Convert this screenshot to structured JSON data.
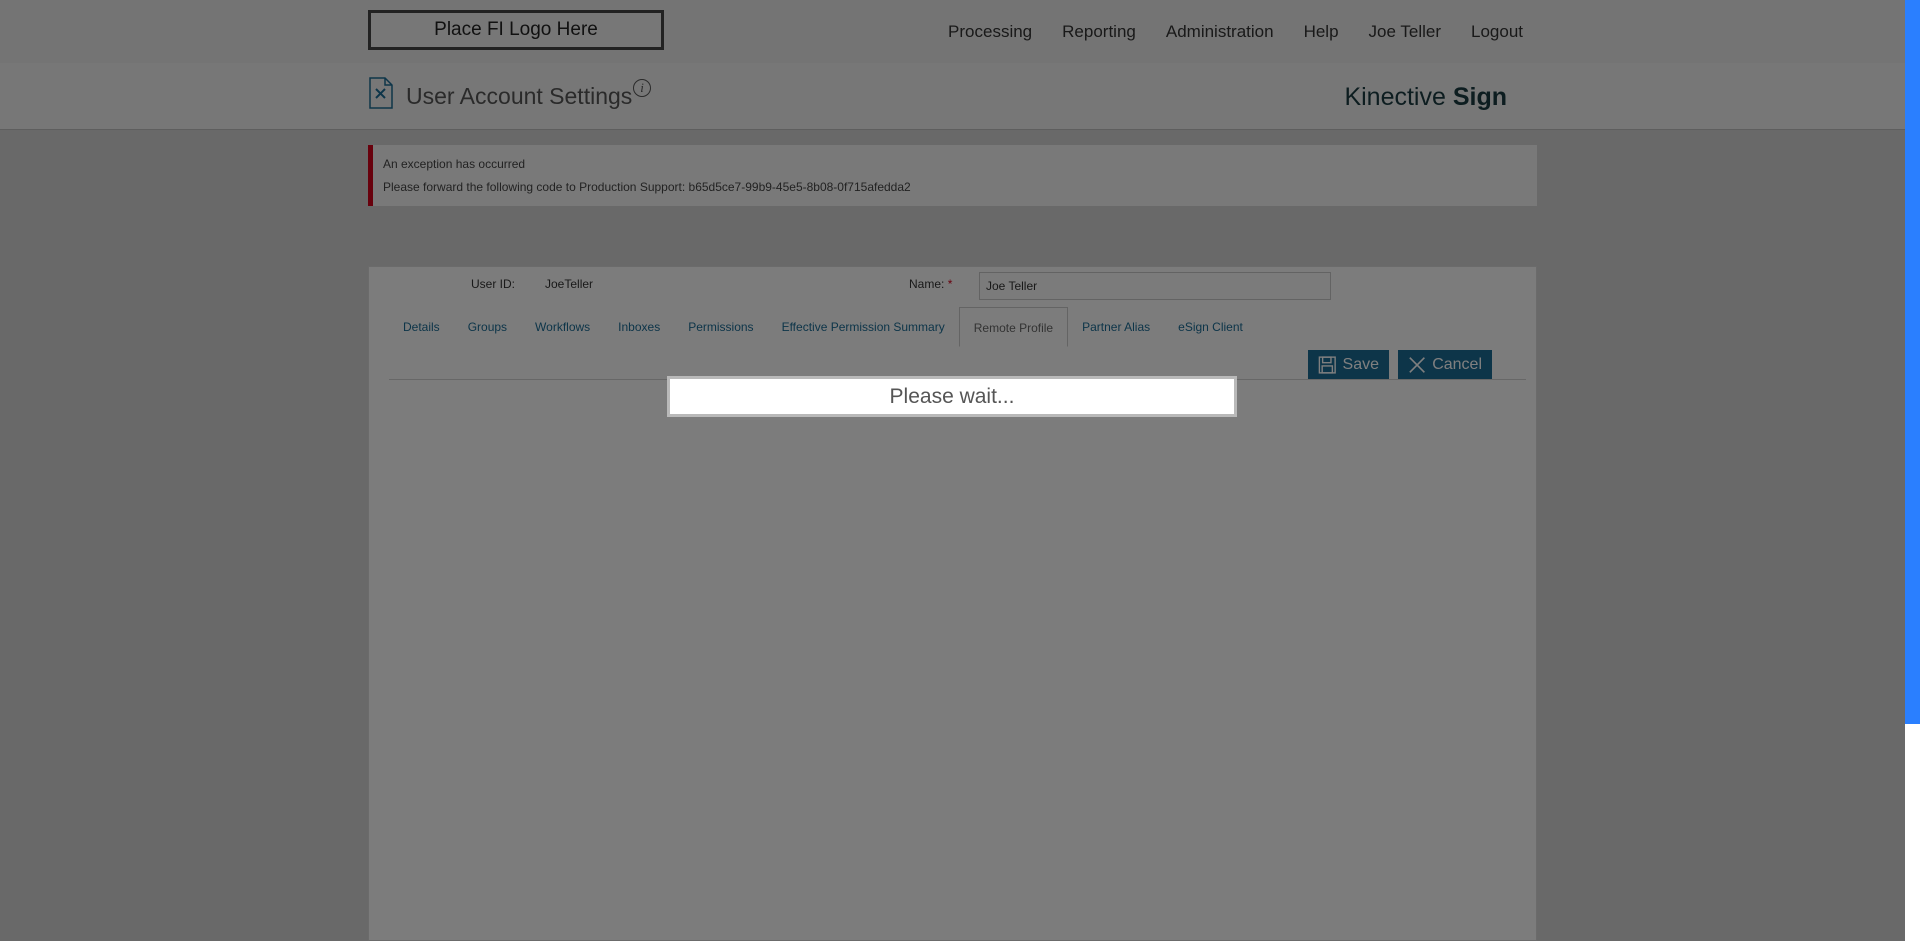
{
  "header": {
    "logo_text": "Place FI Logo Here",
    "nav": [
      "Processing",
      "Reporting",
      "Administration",
      "Help",
      "Joe Teller",
      "Logout"
    ]
  },
  "subheader": {
    "title": "User Account Settings",
    "info_glyph": "i",
    "brand_regular": "Kinective ",
    "brand_bold": "Sign"
  },
  "alert": {
    "title": "An exception has occurred",
    "message": "Please forward the following code to Production Support: b65d5ce7-99b9-45e5-8b08-0f715afedda2",
    "color": "#d0021b"
  },
  "form": {
    "user_id_label": "User ID:",
    "user_id_value": "JoeTeller",
    "name_label": "Name:",
    "required_mark": "*",
    "name_value": "Joe Teller",
    "tabs": [
      "Details",
      "Groups",
      "Workflows",
      "Inboxes",
      "Permissions",
      "Effective Permission Summary",
      "Remote Profile",
      "Partner Alias",
      "eSign Client"
    ],
    "active_tab": "Remote Profile",
    "save_label": "Save",
    "cancel_label": "Cancel",
    "accent_color": "#1b6a93"
  },
  "overlay": {
    "wait_text": "Please wait..."
  },
  "icons": {
    "page_icon": "document-settings-icon",
    "info_icon": "info-icon",
    "save_icon": "floppy-disk-icon",
    "cancel_icon": "close-icon"
  }
}
